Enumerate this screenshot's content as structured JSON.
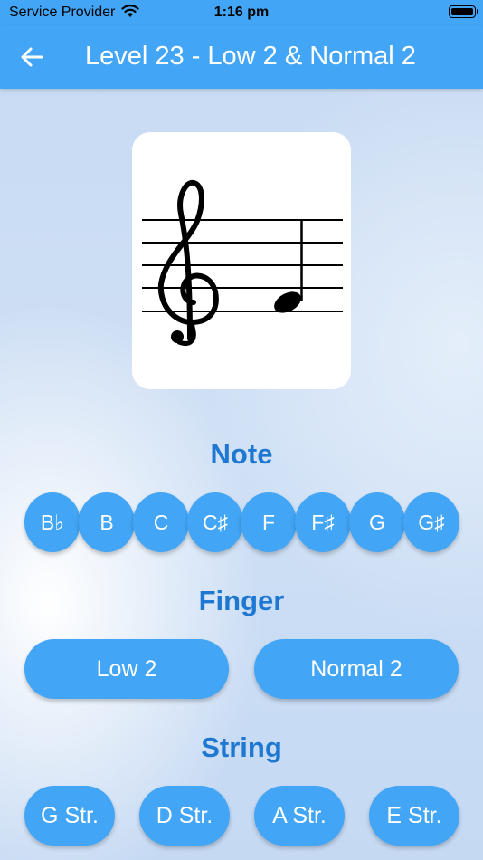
{
  "status_bar": {
    "carrier": "Service Provider",
    "time": "1:16 pm"
  },
  "app_bar": {
    "title": "Level 23 - Low 2 & Normal 2",
    "back_icon": "arrow-left-icon"
  },
  "note_card": {
    "clef": "treble-clef",
    "note": "quarter-note"
  },
  "sections": {
    "note": {
      "title": "Note",
      "options": [
        "B♭",
        "B",
        "C",
        "C♯",
        "F",
        "F♯",
        "G",
        "G♯"
      ]
    },
    "finger": {
      "title": "Finger",
      "options": [
        "Low 2",
        "Normal 2"
      ]
    },
    "string": {
      "title": "String",
      "options": [
        "G Str.",
        "D Str.",
        "A Str.",
        "E Str."
      ]
    }
  },
  "colors": {
    "primary": "#42a5f5",
    "section_title": "#1e78d2",
    "background": "#c9dcf3"
  }
}
